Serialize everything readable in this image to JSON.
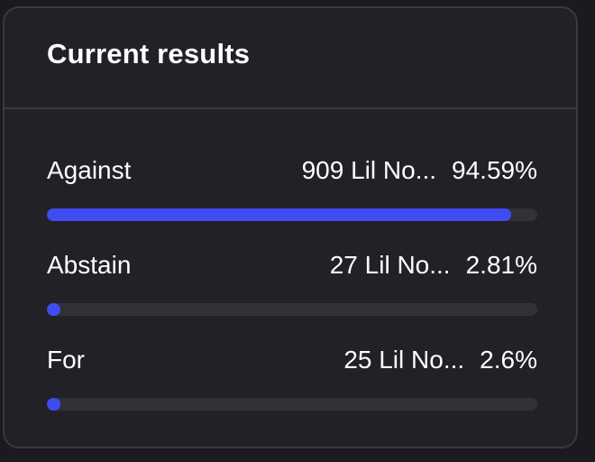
{
  "card": {
    "title": "Current results"
  },
  "colors": {
    "background": "#1b1a1f",
    "card": "#222127",
    "border": "#3a3940",
    "bar_track": "#323137",
    "bar_fill": "#3f4cf0",
    "text": "#ffffff"
  },
  "results": [
    {
      "label": "Against",
      "votes": "909 Lil No...",
      "percent": "94.59%",
      "fill": 0.9459
    },
    {
      "label": "Abstain",
      "votes": "27 Lil No...",
      "percent": "2.81%",
      "fill": 0.0281
    },
    {
      "label": "For",
      "votes": "25 Lil No...",
      "percent": "2.6%",
      "fill": 0.026
    }
  ]
}
